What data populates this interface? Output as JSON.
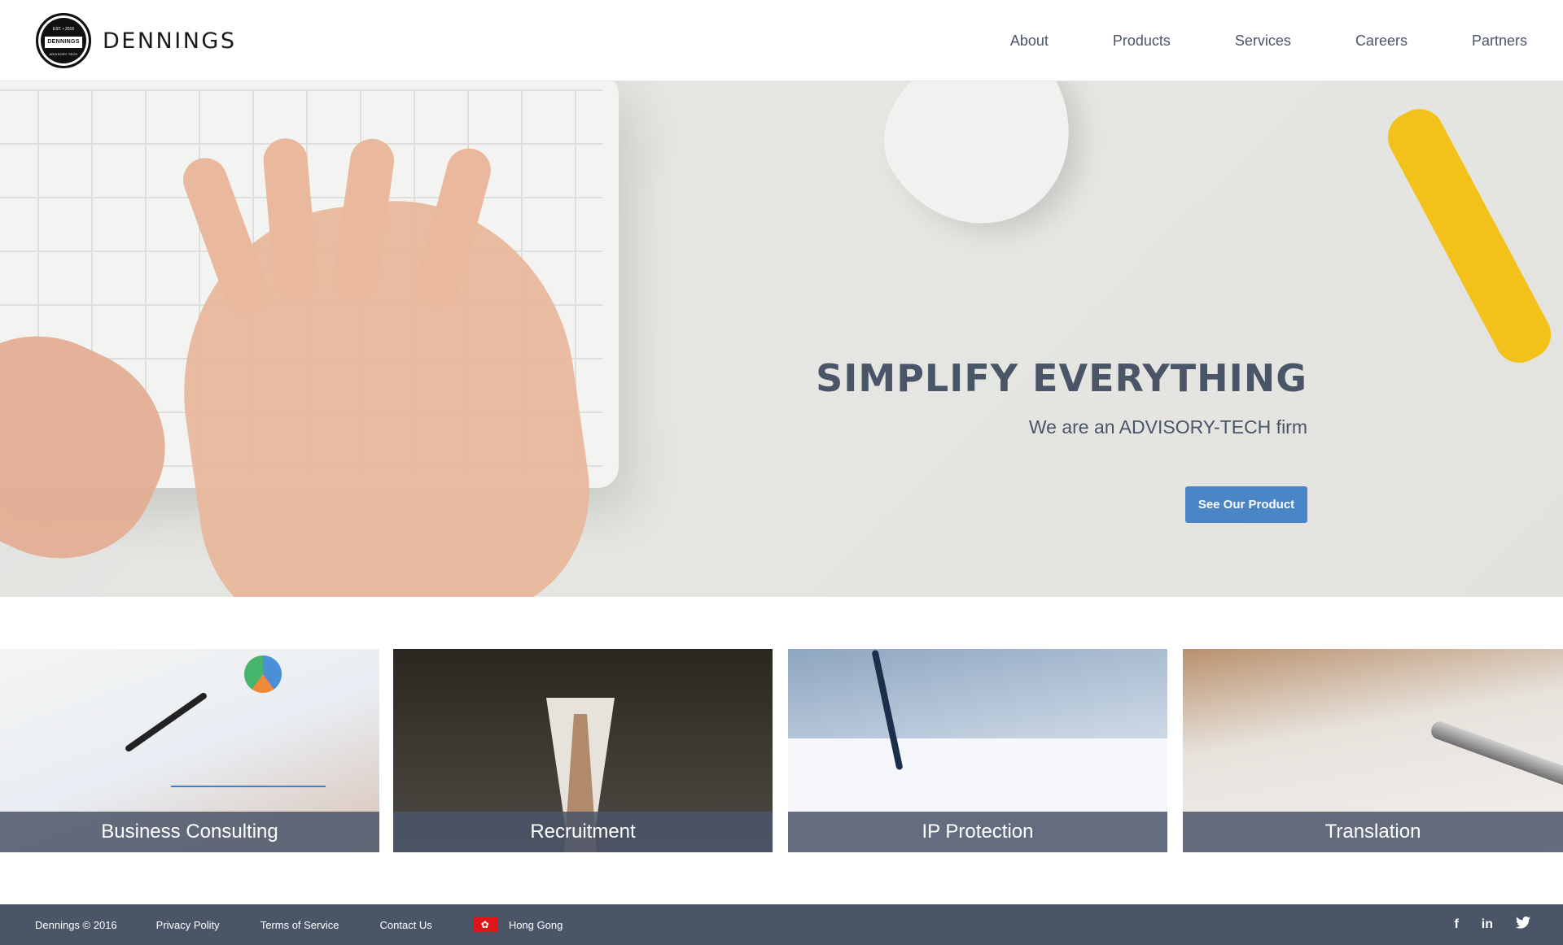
{
  "header": {
    "brand": "DENNINGS",
    "badge": {
      "est": "EST. • 2016",
      "band": "DENNINGS",
      "sub": "ADVISORY TECH"
    },
    "nav": [
      {
        "label": "About"
      },
      {
        "label": "Products"
      },
      {
        "label": "Services"
      },
      {
        "label": "Careers"
      },
      {
        "label": "Partners"
      }
    ]
  },
  "hero": {
    "title": "SIMPLIFY EVERYTHING",
    "subtitle": "We are an ADVISORY-TECH firm",
    "cta_label": "See Our Product"
  },
  "services": [
    {
      "label": "Business Consulting"
    },
    {
      "label": "Recruitment"
    },
    {
      "label": "IP Protection"
    },
    {
      "label": "Translation"
    }
  ],
  "footer": {
    "copyright": "Dennings © 2016",
    "links": [
      {
        "label": "Privacy Polity"
      },
      {
        "label": "Terms of Service"
      },
      {
        "label": "Contact Us"
      }
    ],
    "region": "Hong Gong",
    "social": [
      {
        "icon": "facebook-icon",
        "glyph": "f"
      },
      {
        "icon": "linkedin-icon",
        "glyph": "in"
      },
      {
        "icon": "twitter-icon",
        "glyph": "🐦"
      }
    ]
  },
  "colors": {
    "accent": "#4a86c5",
    "text": "#4a5568",
    "footer_bg": "#4a5568",
    "caption_bg": "#4a5568"
  }
}
